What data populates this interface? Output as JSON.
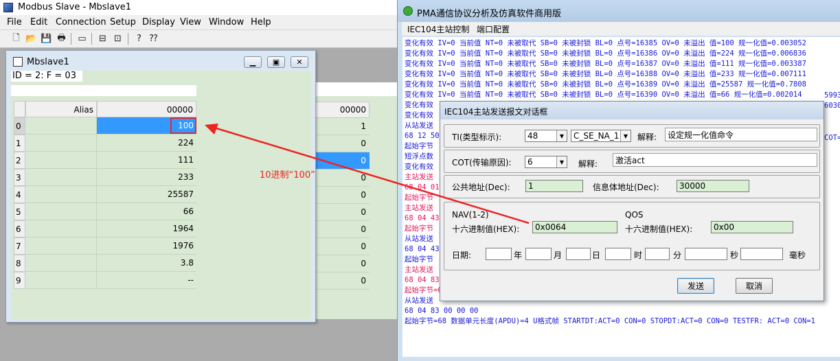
{
  "modbus": {
    "window_title": "Modbus Slave - Mbslave1",
    "menu": [
      "File",
      "Edit",
      "Connection",
      "Setup",
      "Display",
      "View",
      "Window",
      "Help"
    ],
    "child": {
      "title": "Mbslave1",
      "id_line": "ID = 2: F = 03",
      "col_alias": "Alias",
      "col_addr": "00000",
      "rows": [
        {
          "idx": "0",
          "value": "100"
        },
        {
          "idx": "1",
          "value": "224"
        },
        {
          "idx": "2",
          "value": "111"
        },
        {
          "idx": "3",
          "value": "233"
        },
        {
          "idx": "4",
          "value": "25587"
        },
        {
          "idx": "5",
          "value": "66"
        },
        {
          "idx": "6",
          "value": "1964"
        },
        {
          "idx": "7",
          "value": "1976"
        },
        {
          "idx": "8",
          "value": "3.8"
        },
        {
          "idx": "9",
          "value": "--"
        }
      ]
    },
    "bg_child": {
      "col_addr": "00000",
      "values": [
        "1",
        "0",
        "0",
        "0",
        "0",
        "0",
        "0",
        "0",
        "0",
        "0"
      ]
    }
  },
  "annotation": {
    "label": "10进制“100”",
    "color": "#ee2222"
  },
  "pma": {
    "window_title": "PMA通信协议分析及仿真软件商用版",
    "menu": [
      "IEC104主站控制",
      "端口配置"
    ],
    "log_lines": [
      {
        "text": " 变化有效 IV=0  当前值 NT=0  未被取代 SB=0  未被封锁 BL=0 点号=16385 OV=0 未溢出  值=100 规一化值=0.003052",
        "color": "blue"
      },
      {
        "text": " 变化有效 IV=0  当前值 NT=0  未被取代 SB=0  未被封锁 BL=0 点号=16386 OV=0 未溢出  值=224 规一化值=0.006836",
        "color": "blue"
      },
      {
        "text": " 变化有效 IV=0  当前值 NT=0  未被取代 SB=0  未被封锁 BL=0 点号=16387 OV=0 未溢出  值=111 规一化值=0.003387",
        "color": "blue"
      },
      {
        "text": " 变化有效 IV=0  当前值 NT=0  未被取代 SB=0  未被封锁 BL=0 点号=16388 OV=0 未溢出  值=233 规一化值=0.007111",
        "color": "blue"
      },
      {
        "text": " 变化有效 IV=0  当前值 NT=0  未被取代 SB=0  未被封锁 BL=0 点号=16389 OV=0 未溢出  值=25587 规一化值=0.7808",
        "color": "blue"
      },
      {
        "text": " 变化有效 IV=0  当前值 NT=0  未被取代 SB=0  未被封锁 BL=0 点号=16390 OV=0 未溢出  值=66 规一化值=0.002014",
        "color": "blue"
      },
      {
        "text": " 变化有效",
        "color": "blue"
      },
      {
        "text": " 变化有效",
        "color": "blue"
      },
      {
        "text": "从站发送",
        "color": "blue"
      },
      {
        "text": "68 12 50",
        "color": "blue"
      },
      {
        "text": "起始字节",
        "color": "blue"
      },
      {
        "text": "短浮点数",
        "color": "blue"
      },
      {
        "text": " 变化有效",
        "color": "blue"
      },
      {
        "text": "主站发送",
        "color": "red"
      },
      {
        "text": "68 04 01",
        "color": "red"
      },
      {
        "text": "起始字节",
        "color": "red"
      },
      {
        "text": "主站发送",
        "color": "red"
      },
      {
        "text": "68 04 43",
        "color": "red"
      },
      {
        "text": "起始字节",
        "color": "red"
      },
      {
        "text": "从站发送",
        "color": "blue"
      },
      {
        "text": "68 04 43",
        "color": "blue"
      },
      {
        "text": "起始字节",
        "color": "blue"
      },
      {
        "text": "主站发送",
        "color": "red"
      },
      {
        "text": "68 04 83",
        "color": "red"
      },
      {
        "text": "起始字节=68 数据单元长度(APDU)=4 U格式帧 STARTDT:ACT=0 CON=0 STOPDT:ACT=0 CON=0 TESTFR: ACT=0 CON=1",
        "color": "red"
      },
      {
        "text": "从站发送",
        "color": "blue"
      },
      {
        "text": "68 04 83 00 00 00",
        "color": "blue"
      },
      {
        "text": "起始字节=68 数据单元长度(APDU)=4 U格式帧 STARTDT:ACT=0 CON=0 STOPDT:ACT=0 CON=0 TESTFR: ACT=0 CON=1",
        "color": "blue"
      }
    ],
    "log_right_fragments": [
      "5993",
      "6030",
      "COT="
    ],
    "dialog": {
      "title": "IEC104主站发送报文对话框",
      "ti_label": "TI(类型标示):",
      "ti_value": "48",
      "ti_name": "C_SE_NA_1",
      "explain_label": "解释:",
      "ti_explain": "设定规一化值命令",
      "cot_label": "COT(传输原因):",
      "cot_value": "6",
      "cot_explain": "激活act",
      "common_addr_label": "公共地址(Dec):",
      "common_addr_value": "1",
      "ioa_label": "信息体地址(Dec):",
      "ioa_value": "30000",
      "nav_label": "NAV(1-2)",
      "nav_hex_label": "十六进制值(HEX):",
      "nav_hex_value": "0x0064",
      "qos_label": "QOS",
      "qos_hex_label": "十六进制值(HEX):",
      "qos_hex_value": "0x00",
      "date_label": "日期:",
      "date_units": [
        "年",
        "月",
        "日",
        "时",
        "分",
        "秒",
        "毫秒"
      ],
      "send_button": "发送",
      "cancel_button": "取消"
    }
  }
}
